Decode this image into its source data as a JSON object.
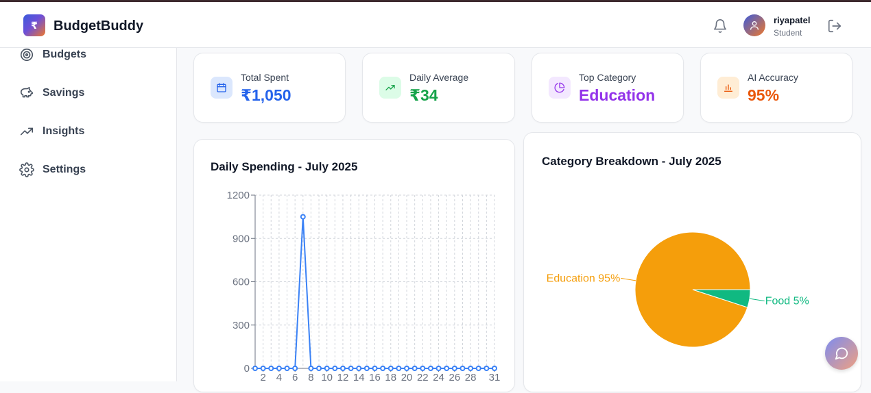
{
  "app": {
    "logo_symbol": "₹",
    "title": "BudgetBuddy"
  },
  "user": {
    "name": "riyapatel",
    "role": "Student"
  },
  "sidebar": {
    "items": [
      {
        "label": "Budgets",
        "icon": "target-icon"
      },
      {
        "label": "Savings",
        "icon": "piggy-bank-icon"
      },
      {
        "label": "Insights",
        "icon": "trending-up-icon"
      },
      {
        "label": "Settings",
        "icon": "gear-icon"
      }
    ]
  },
  "stats": [
    {
      "label": "Total Spent",
      "value": "₹1,050",
      "color": "#2563eb",
      "bg": "#dbe7fd",
      "icon": "calendar-icon"
    },
    {
      "label": "Daily Average",
      "value": "₹34",
      "color": "#16a34a",
      "bg": "#dcfce7",
      "icon": "trending-up-icon"
    },
    {
      "label": "Top Category",
      "value": "Education",
      "color": "#9333ea",
      "bg": "#f3e8ff",
      "icon": "pie-chart-icon"
    },
    {
      "label": "AI Accuracy",
      "value": "95%",
      "color": "#ea580c",
      "bg": "#ffedd5",
      "icon": "bar-chart-icon"
    }
  ],
  "line_chart": {
    "title": "Daily Spending - July 2025"
  },
  "pie_chart": {
    "title": "Category Breakdown - July 2025"
  },
  "chart_data": [
    {
      "type": "line",
      "title": "Daily Spending - July 2025",
      "x": [
        1,
        2,
        3,
        4,
        5,
        6,
        7,
        8,
        9,
        10,
        11,
        12,
        13,
        14,
        15,
        16,
        17,
        18,
        19,
        20,
        21,
        22,
        23,
        24,
        25,
        26,
        27,
        28,
        29,
        30,
        31
      ],
      "series": [
        {
          "values": [
            0,
            0,
            0,
            0,
            0,
            0,
            1050,
            0,
            0,
            0,
            0,
            0,
            0,
            0,
            0,
            0,
            0,
            0,
            0,
            0,
            0,
            0,
            0,
            0,
            0,
            0,
            0,
            0,
            0,
            0,
            0
          ],
          "color": "#3b82f6"
        }
      ],
      "x_tick_labels": [
        "2",
        "4",
        "6",
        "8",
        "10",
        "12",
        "14",
        "16",
        "18",
        "20",
        "22",
        "24",
        "26",
        "28",
        "31"
      ],
      "y_ticks": [
        0,
        300,
        600,
        900,
        1200
      ],
      "ylim": [
        0,
        1200
      ],
      "grid": true
    },
    {
      "type": "pie",
      "title": "Category Breakdown - July 2025",
      "slices": [
        {
          "label": "Education",
          "value": 95,
          "text": "Education 95%",
          "color": "#f59e0b"
        },
        {
          "label": "Food",
          "value": 5,
          "text": "Food 5%",
          "color": "#10b981"
        }
      ]
    }
  ]
}
